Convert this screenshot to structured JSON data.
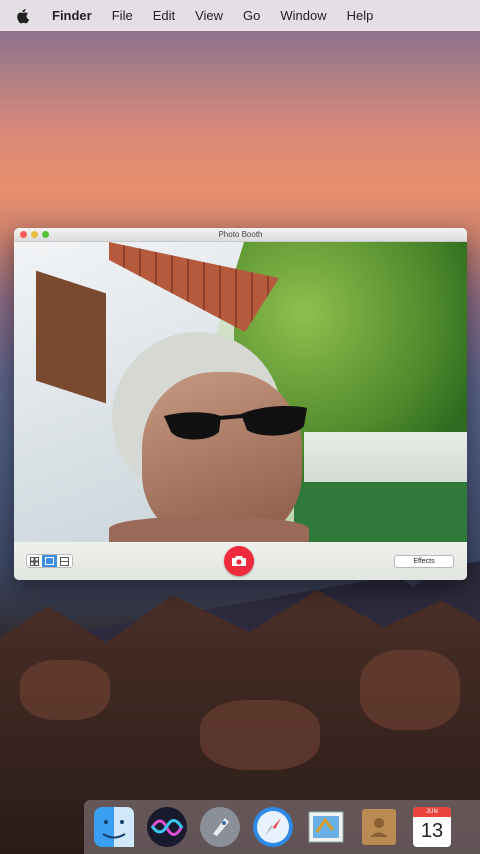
{
  "menubar": {
    "app_name": "Finder",
    "items": [
      "File",
      "Edit",
      "View",
      "Go",
      "Window",
      "Help"
    ]
  },
  "photobooth": {
    "title": "Photo Booth",
    "effects_label": "Effects"
  },
  "dock": {
    "items": [
      "finder-icon",
      "siri-icon",
      "launchpad-icon",
      "safari-icon",
      "mail-icon",
      "contacts-icon",
      "calendar-icon"
    ],
    "calendar_month": "JUN",
    "calendar_day": "13"
  },
  "colors": {
    "shutter": "#ee2a3c",
    "close": "#fc5b57",
    "minimize": "#e5bf3c",
    "zoom": "#57c038"
  }
}
